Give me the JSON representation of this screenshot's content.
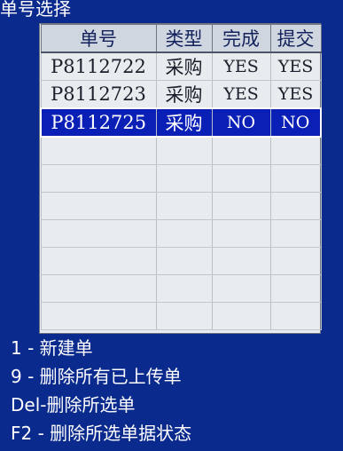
{
  "window": {
    "title": "单号选择"
  },
  "table": {
    "headers": [
      "单号",
      "类型",
      "完成",
      "提交"
    ],
    "rows": [
      {
        "code": "P8112722",
        "type": "采购",
        "done": "YES",
        "submitted": "YES"
      },
      {
        "code": "P8112723",
        "type": "采购",
        "done": "YES",
        "submitted": "YES"
      },
      {
        "code": "P8112725",
        "type": "采购",
        "done": "NO",
        "submitted": "NO"
      }
    ]
  },
  "menu": [
    "1 - 新建单",
    "9 - 删除所有已上传单",
    "Del-删除所选单",
    "F2 - 删除所选单据状态"
  ]
}
